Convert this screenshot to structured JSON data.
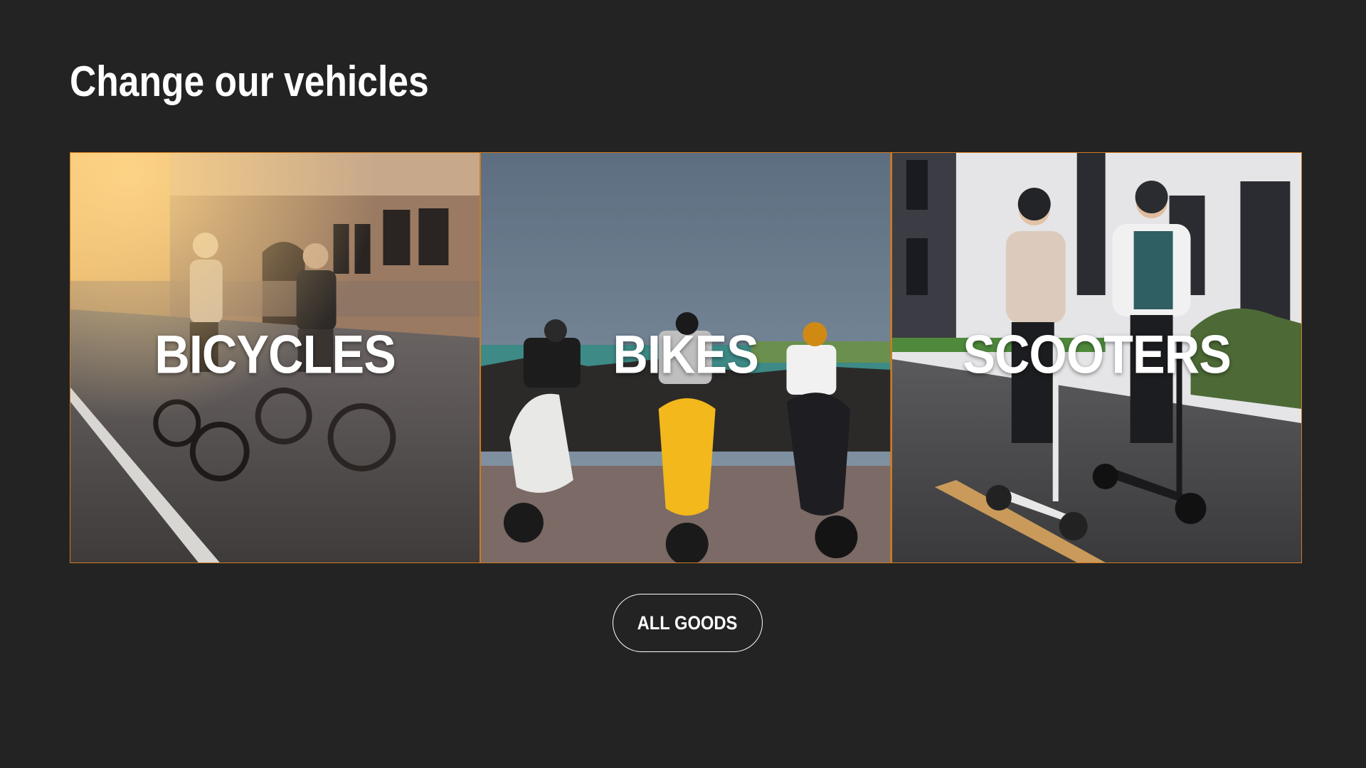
{
  "section": {
    "title": "Change our vehicles"
  },
  "categories": [
    {
      "label": "BICYCLES"
    },
    {
      "label": "BIKES"
    },
    {
      "label": "SCOOTERS"
    }
  ],
  "cta": {
    "label": "ALL GOODS"
  },
  "colors": {
    "background": "#222322",
    "accent_border": "#d07a1e",
    "text": "#ffffff"
  }
}
